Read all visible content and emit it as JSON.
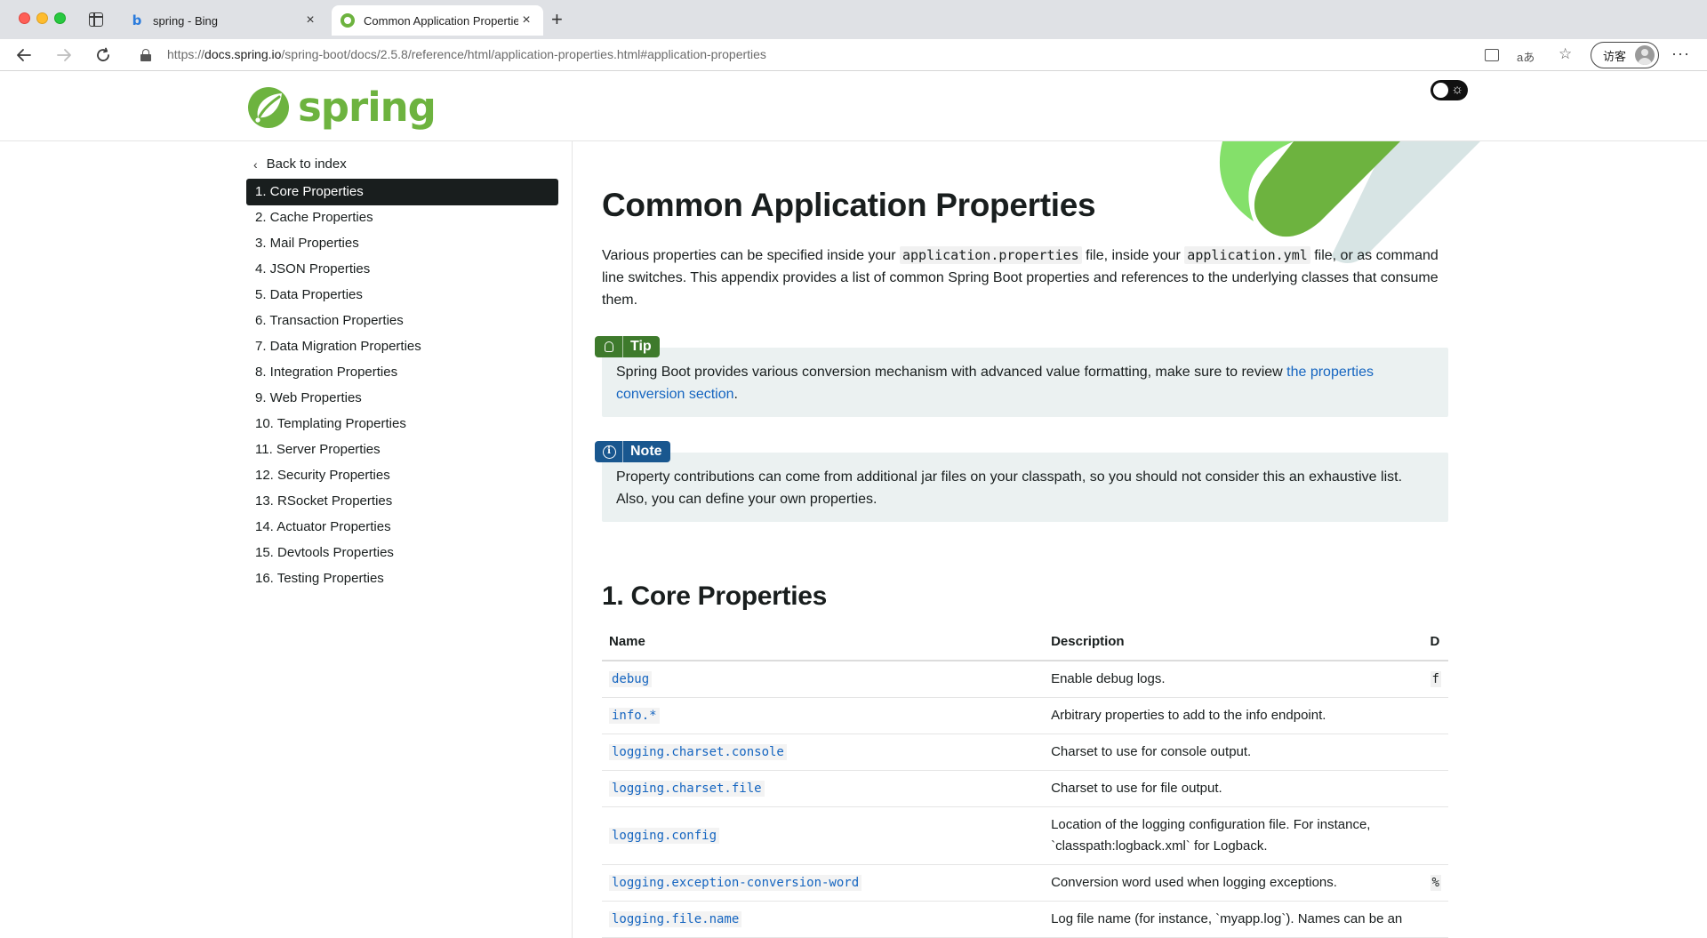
{
  "browser": {
    "tabs": [
      {
        "title": "spring - Bing",
        "active": false,
        "icon": "bing-icon"
      },
      {
        "title": "Common Application Properties",
        "active": true,
        "icon": "spring-favicon"
      }
    ],
    "new_tab": "+",
    "url": {
      "scheme": "https://",
      "host": "docs.spring.io",
      "path": "/spring-boot/docs/2.5.8/reference/html/application-properties.html#application-properties"
    },
    "profile_label": "访客",
    "translate_glyph": "aあ"
  },
  "site": {
    "logo_text": "spring",
    "brand_color": "#6db33f"
  },
  "sidebar": {
    "back_label": "Back to index",
    "items": [
      {
        "label": "1. Core Properties",
        "active": true
      },
      {
        "label": "2. Cache Properties"
      },
      {
        "label": "3. Mail Properties"
      },
      {
        "label": "4. JSON Properties"
      },
      {
        "label": "5. Data Properties"
      },
      {
        "label": "6. Transaction Properties"
      },
      {
        "label": "7. Data Migration Properties"
      },
      {
        "label": "8. Integration Properties"
      },
      {
        "label": "9. Web Properties"
      },
      {
        "label": "10. Templating Properties"
      },
      {
        "label": "11. Server Properties"
      },
      {
        "label": "12. Security Properties"
      },
      {
        "label": "13. RSocket Properties"
      },
      {
        "label": "14. Actuator Properties"
      },
      {
        "label": "15. Devtools Properties"
      },
      {
        "label": "16. Testing Properties"
      }
    ]
  },
  "main": {
    "title": "Common Application Properties",
    "intro": {
      "t1": "Various properties can be specified inside your ",
      "code1": "application.properties",
      "t2": " file, inside your ",
      "code2": "application.yml",
      "t3": " file, or as command line switches. This appendix provides a list of common Spring Boot properties and references to the underlying classes that consume them."
    },
    "tip": {
      "label": "Tip",
      "text": "Spring Boot provides various conversion mechanism with advanced value formatting, make sure to review ",
      "link": "the properties conversion section",
      "end": "."
    },
    "note": {
      "label": "Note",
      "text": "Property contributions can come from additional jar files on your classpath, so you should not consider this an exhaustive list. Also, you can define your own properties."
    },
    "section_title": "1. Core Properties",
    "table": {
      "headers": [
        "Name",
        "Description",
        "D"
      ],
      "rows": [
        {
          "name": "debug",
          "desc": "Enable debug logs.",
          "default": "f"
        },
        {
          "name": "info.*",
          "desc": "Arbitrary properties to add to the info endpoint.",
          "default": ""
        },
        {
          "name": "logging.charset.console",
          "desc": "Charset to use for console output.",
          "default": ""
        },
        {
          "name": "logging.charset.file",
          "desc": "Charset to use for file output.",
          "default": ""
        },
        {
          "name": "logging.config",
          "desc": "Location of the logging configuration file. For instance, `classpath:logback.xml` for Logback.",
          "default": ""
        },
        {
          "name": "logging.exception-conversion-word",
          "desc": "Conversion word used when logging exceptions.",
          "default": "%"
        },
        {
          "name": "logging.file.name",
          "desc": "Log file name (for instance, `myapp.log`). Names can be an",
          "default": ""
        }
      ]
    }
  }
}
